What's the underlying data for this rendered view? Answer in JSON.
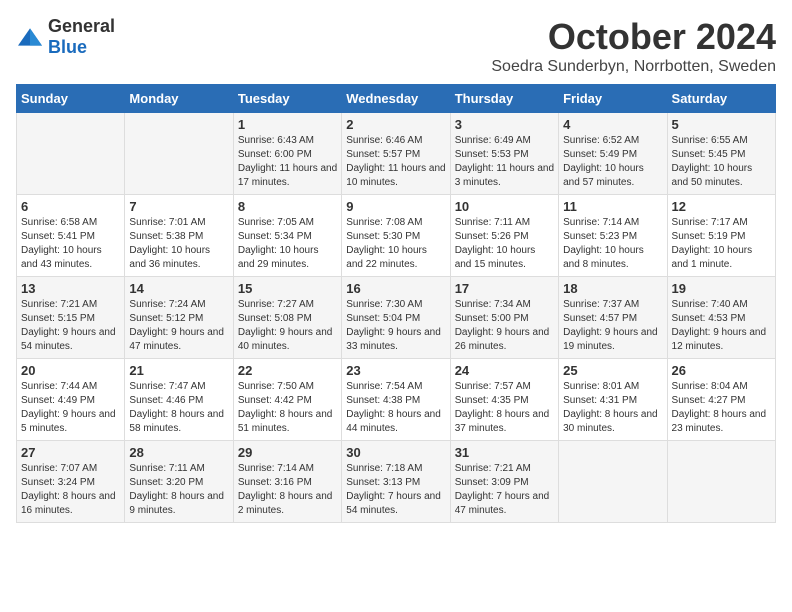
{
  "logo": {
    "general": "General",
    "blue": "Blue"
  },
  "header": {
    "month": "October 2024",
    "location": "Soedra Sunderbyn, Norrbotten, Sweden"
  },
  "weekdays": [
    "Sunday",
    "Monday",
    "Tuesday",
    "Wednesday",
    "Thursday",
    "Friday",
    "Saturday"
  ],
  "weeks": [
    [
      {
        "day": "",
        "sunrise": "",
        "sunset": "",
        "daylight": ""
      },
      {
        "day": "",
        "sunrise": "",
        "sunset": "",
        "daylight": ""
      },
      {
        "day": "1",
        "sunrise": "Sunrise: 6:43 AM",
        "sunset": "Sunset: 6:00 PM",
        "daylight": "Daylight: 11 hours and 17 minutes."
      },
      {
        "day": "2",
        "sunrise": "Sunrise: 6:46 AM",
        "sunset": "Sunset: 5:57 PM",
        "daylight": "Daylight: 11 hours and 10 minutes."
      },
      {
        "day": "3",
        "sunrise": "Sunrise: 6:49 AM",
        "sunset": "Sunset: 5:53 PM",
        "daylight": "Daylight: 11 hours and 3 minutes."
      },
      {
        "day": "4",
        "sunrise": "Sunrise: 6:52 AM",
        "sunset": "Sunset: 5:49 PM",
        "daylight": "Daylight: 10 hours and 57 minutes."
      },
      {
        "day": "5",
        "sunrise": "Sunrise: 6:55 AM",
        "sunset": "Sunset: 5:45 PM",
        "daylight": "Daylight: 10 hours and 50 minutes."
      }
    ],
    [
      {
        "day": "6",
        "sunrise": "Sunrise: 6:58 AM",
        "sunset": "Sunset: 5:41 PM",
        "daylight": "Daylight: 10 hours and 43 minutes."
      },
      {
        "day": "7",
        "sunrise": "Sunrise: 7:01 AM",
        "sunset": "Sunset: 5:38 PM",
        "daylight": "Daylight: 10 hours and 36 minutes."
      },
      {
        "day": "8",
        "sunrise": "Sunrise: 7:05 AM",
        "sunset": "Sunset: 5:34 PM",
        "daylight": "Daylight: 10 hours and 29 minutes."
      },
      {
        "day": "9",
        "sunrise": "Sunrise: 7:08 AM",
        "sunset": "Sunset: 5:30 PM",
        "daylight": "Daylight: 10 hours and 22 minutes."
      },
      {
        "day": "10",
        "sunrise": "Sunrise: 7:11 AM",
        "sunset": "Sunset: 5:26 PM",
        "daylight": "Daylight: 10 hours and 15 minutes."
      },
      {
        "day": "11",
        "sunrise": "Sunrise: 7:14 AM",
        "sunset": "Sunset: 5:23 PM",
        "daylight": "Daylight: 10 hours and 8 minutes."
      },
      {
        "day": "12",
        "sunrise": "Sunrise: 7:17 AM",
        "sunset": "Sunset: 5:19 PM",
        "daylight": "Daylight: 10 hours and 1 minute."
      }
    ],
    [
      {
        "day": "13",
        "sunrise": "Sunrise: 7:21 AM",
        "sunset": "Sunset: 5:15 PM",
        "daylight": "Daylight: 9 hours and 54 minutes."
      },
      {
        "day": "14",
        "sunrise": "Sunrise: 7:24 AM",
        "sunset": "Sunset: 5:12 PM",
        "daylight": "Daylight: 9 hours and 47 minutes."
      },
      {
        "day": "15",
        "sunrise": "Sunrise: 7:27 AM",
        "sunset": "Sunset: 5:08 PM",
        "daylight": "Daylight: 9 hours and 40 minutes."
      },
      {
        "day": "16",
        "sunrise": "Sunrise: 7:30 AM",
        "sunset": "Sunset: 5:04 PM",
        "daylight": "Daylight: 9 hours and 33 minutes."
      },
      {
        "day": "17",
        "sunrise": "Sunrise: 7:34 AM",
        "sunset": "Sunset: 5:00 PM",
        "daylight": "Daylight: 9 hours and 26 minutes."
      },
      {
        "day": "18",
        "sunrise": "Sunrise: 7:37 AM",
        "sunset": "Sunset: 4:57 PM",
        "daylight": "Daylight: 9 hours and 19 minutes."
      },
      {
        "day": "19",
        "sunrise": "Sunrise: 7:40 AM",
        "sunset": "Sunset: 4:53 PM",
        "daylight": "Daylight: 9 hours and 12 minutes."
      }
    ],
    [
      {
        "day": "20",
        "sunrise": "Sunrise: 7:44 AM",
        "sunset": "Sunset: 4:49 PM",
        "daylight": "Daylight: 9 hours and 5 minutes."
      },
      {
        "day": "21",
        "sunrise": "Sunrise: 7:47 AM",
        "sunset": "Sunset: 4:46 PM",
        "daylight": "Daylight: 8 hours and 58 minutes."
      },
      {
        "day": "22",
        "sunrise": "Sunrise: 7:50 AM",
        "sunset": "Sunset: 4:42 PM",
        "daylight": "Daylight: 8 hours and 51 minutes."
      },
      {
        "day": "23",
        "sunrise": "Sunrise: 7:54 AM",
        "sunset": "Sunset: 4:38 PM",
        "daylight": "Daylight: 8 hours and 44 minutes."
      },
      {
        "day": "24",
        "sunrise": "Sunrise: 7:57 AM",
        "sunset": "Sunset: 4:35 PM",
        "daylight": "Daylight: 8 hours and 37 minutes."
      },
      {
        "day": "25",
        "sunrise": "Sunrise: 8:01 AM",
        "sunset": "Sunset: 4:31 PM",
        "daylight": "Daylight: 8 hours and 30 minutes."
      },
      {
        "day": "26",
        "sunrise": "Sunrise: 8:04 AM",
        "sunset": "Sunset: 4:27 PM",
        "daylight": "Daylight: 8 hours and 23 minutes."
      }
    ],
    [
      {
        "day": "27",
        "sunrise": "Sunrise: 7:07 AM",
        "sunset": "Sunset: 3:24 PM",
        "daylight": "Daylight: 8 hours and 16 minutes."
      },
      {
        "day": "28",
        "sunrise": "Sunrise: 7:11 AM",
        "sunset": "Sunset: 3:20 PM",
        "daylight": "Daylight: 8 hours and 9 minutes."
      },
      {
        "day": "29",
        "sunrise": "Sunrise: 7:14 AM",
        "sunset": "Sunset: 3:16 PM",
        "daylight": "Daylight: 8 hours and 2 minutes."
      },
      {
        "day": "30",
        "sunrise": "Sunrise: 7:18 AM",
        "sunset": "Sunset: 3:13 PM",
        "daylight": "Daylight: 7 hours and 54 minutes."
      },
      {
        "day": "31",
        "sunrise": "Sunrise: 7:21 AM",
        "sunset": "Sunset: 3:09 PM",
        "daylight": "Daylight: 7 hours and 47 minutes."
      },
      {
        "day": "",
        "sunrise": "",
        "sunset": "",
        "daylight": ""
      },
      {
        "day": "",
        "sunrise": "",
        "sunset": "",
        "daylight": ""
      }
    ]
  ]
}
